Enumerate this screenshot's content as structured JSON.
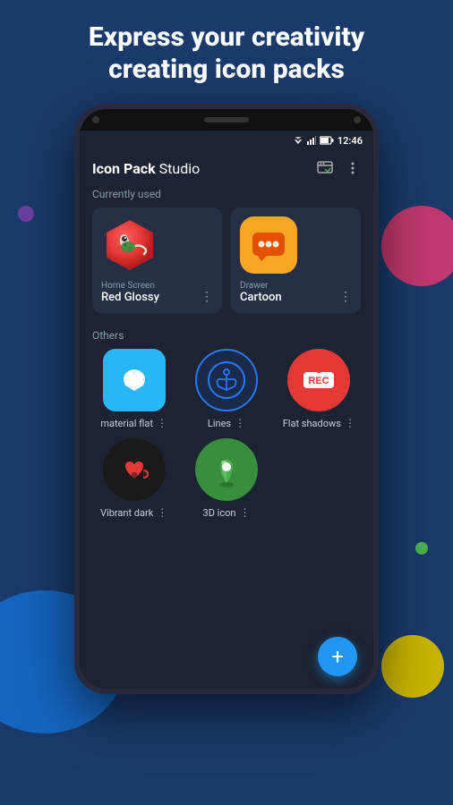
{
  "header": {
    "line1": "Express your creativity",
    "line2": "creating icon packs"
  },
  "phone": {
    "status_bar": {
      "time": "12:46"
    },
    "toolbar": {
      "title_bold": "Icon Pack",
      "title_normal": " Studio",
      "shield_icon": "shield-icon",
      "more_icon": "more-vert-icon"
    },
    "currently_used_label": "Currently used",
    "currently_used": [
      {
        "subtitle": "Home Screen",
        "name": "Red Glossy",
        "type": "hexagon-red"
      },
      {
        "subtitle": "Drawer",
        "name": "Cartoon",
        "type": "rounded-yellow"
      }
    ],
    "others_label": "Others",
    "others": [
      {
        "name": "material flat",
        "type": "material-flat"
      },
      {
        "name": "Lines",
        "type": "lines"
      },
      {
        "name": "Flat shadows",
        "type": "flat-shadows"
      },
      {
        "name": "Vibrant dark",
        "type": "vibrant-dark"
      },
      {
        "name": "3D icon",
        "type": "3d-icon"
      }
    ],
    "fab_label": "+"
  }
}
